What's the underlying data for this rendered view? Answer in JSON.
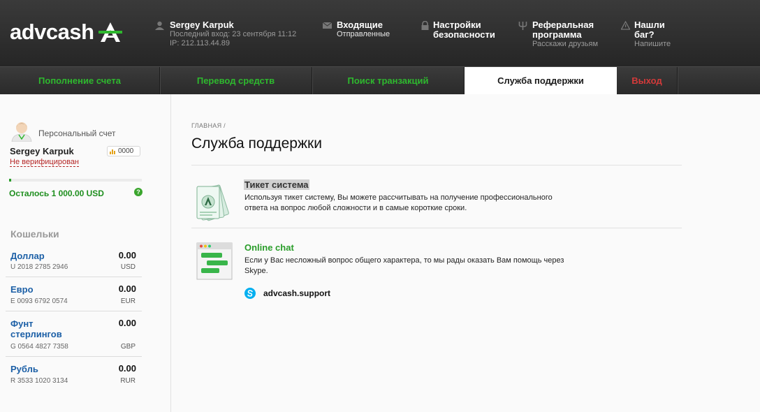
{
  "header": {
    "logo": {
      "part1": "adv",
      "part2": "cash"
    },
    "user": {
      "name": "Sergey Karpuk",
      "last_login": "Последний вход: 23 сентября 11:12",
      "ip": "IP: 212.113.44.89"
    },
    "inbox": {
      "title": "Входящие",
      "sub": "Отправленные"
    },
    "security": {
      "line1": "Настройки",
      "line2": "безопасности"
    },
    "referral": {
      "line1": "Реферальная",
      "line2": "программа",
      "sub": "Расскажи друзьям"
    },
    "bug": {
      "line1": "Нашли",
      "line2": "баг?",
      "sub": "Напишите"
    }
  },
  "nav": {
    "items": [
      {
        "label": "Пополнение счета"
      },
      {
        "label": "Перевод средств"
      },
      {
        "label": "Поиск транзакций"
      },
      {
        "label": "Служба поддержки"
      },
      {
        "label": "Выход"
      }
    ]
  },
  "sidebar": {
    "account_label": "Персональный счет",
    "name": "Sergey Karpuk",
    "rating": "0000",
    "verify_status": "Не верифицирован",
    "limit_text": "Осталось 1 000.00 USD",
    "limit_fraction": 0.015,
    "help": "?",
    "wallets_title": "Кошельки",
    "wallets": [
      {
        "name": "Доллар",
        "number": "U 2018 2785 2946",
        "amount": "0.00",
        "currency": "USD"
      },
      {
        "name": "Евро",
        "number": "E 0093 6792 0574",
        "amount": "0.00",
        "currency": "EUR"
      },
      {
        "name": "Фунт стерлингов",
        "number": "G 0564 4827 7358",
        "amount": "0.00",
        "currency": "GBP"
      },
      {
        "name": "Рубль",
        "number": "R 3533 1020 3134",
        "amount": "0.00",
        "currency": "RUR"
      }
    ]
  },
  "main": {
    "breadcrumb": "ГЛАВНАЯ /",
    "title": "Служба поддержки",
    "ticket": {
      "title": "Тикет система",
      "desc_line1": "Используя тикет систему, Вы можете рассчитывать на получение профессионального",
      "desc_line2": "ответа на вопрос любой сложности и в самые короткие сроки."
    },
    "chat": {
      "title": "Online chat",
      "desc_line1": "Если у Вас несложный вопрос общего характера, то мы рады оказать Вам помощь через",
      "desc_line2": "Skype.",
      "skype": "advcash.support"
    }
  },
  "colors": {
    "accent_green": "#2eb82e",
    "exit_red": "#d43a3a",
    "link_blue": "#1b5fa6",
    "header_bg": "#2e2e2e"
  },
  "icons": [
    "logo-a-icon",
    "user-icon",
    "envelope-icon",
    "lock-icon",
    "trident-icon",
    "warning-icon",
    "avatar-icon",
    "bar-chart-icon",
    "help-icon",
    "ticket-icon",
    "chat-window-icon",
    "skype-icon"
  ]
}
